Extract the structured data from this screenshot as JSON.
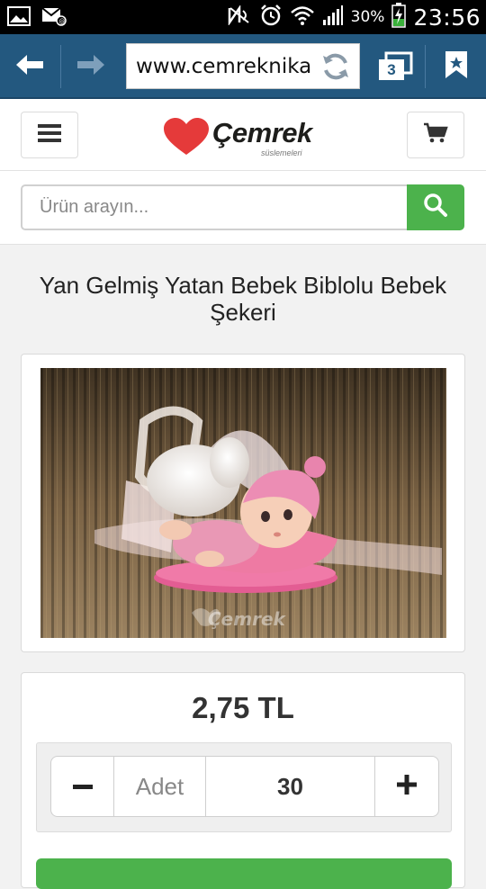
{
  "status_bar": {
    "battery": "30%",
    "time": "23:56",
    "icons": [
      "image-icon",
      "mail-at-icon",
      "nfc-icon",
      "alarm-icon",
      "wifi-icon",
      "signal-icon",
      "battery-charging-icon"
    ]
  },
  "browser": {
    "url": "www.cemreknika",
    "tab_count": "3",
    "icons": [
      "back-arrow-icon",
      "forward-arrow-icon",
      "reload-icon",
      "tabs-icon",
      "bookmark-icon"
    ]
  },
  "header": {
    "brand": "Çemrek",
    "tagline": "süslemeleri",
    "colors": {
      "heart": "#e53a3a"
    }
  },
  "search": {
    "placeholder": "Ürün arayın...",
    "button_color": "#4cb24c"
  },
  "product": {
    "title": "Yan Gelmiş Yatan Bebek Biblolu Bebek Şekeri",
    "image_watermark": "Çemrek",
    "price": "2,75 TL",
    "quantity_label": "Adet",
    "quantity": "30"
  },
  "colors": {
    "browser_bar": "#23587f",
    "accent_green": "#4cb24c"
  }
}
